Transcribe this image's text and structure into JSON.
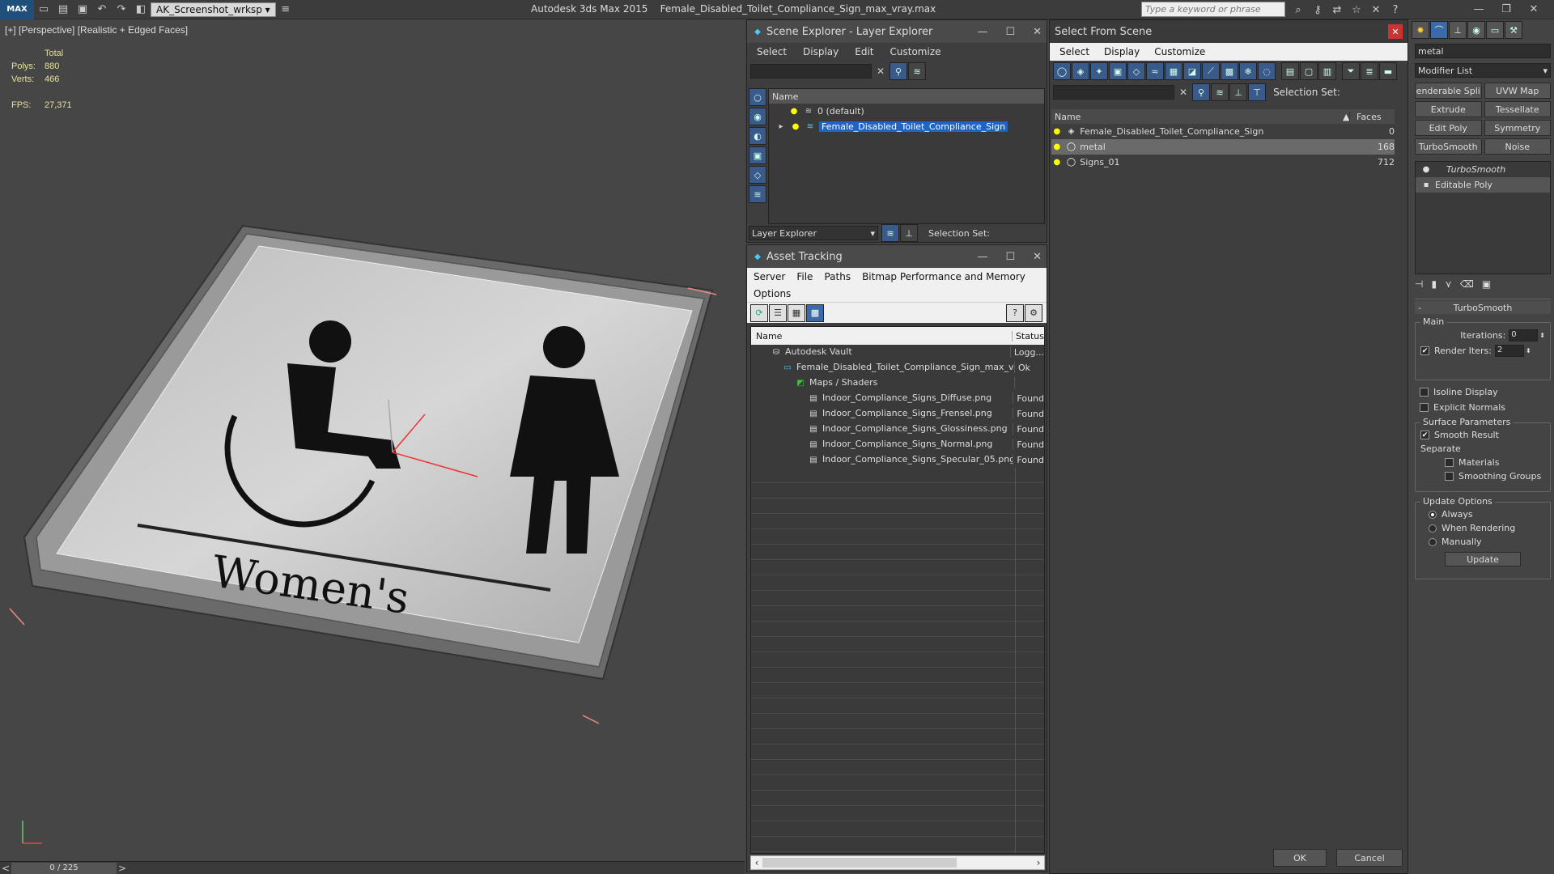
{
  "titlebar": {
    "workspace": "AK_Screenshot_wrksp",
    "app": "Autodesk 3ds Max  2015",
    "file": "Female_Disabled_Toilet_Compliance_Sign_max_vray.max",
    "search_placeholder": "Type a keyword or phrase",
    "logo": "MAX"
  },
  "viewport": {
    "label": "[+] [Perspective] [Realistic + Edged Faces]",
    "stats": {
      "total_label": "Total",
      "polys_label": "Polys:",
      "polys": "880",
      "verts_label": "Verts:",
      "verts": "466",
      "fps_label": "FPS:",
      "fps": "27,371"
    },
    "sign_text": "Women's",
    "timeline": "0 / 225"
  },
  "scene_explorer": {
    "title": "Scene Explorer - Layer Explorer",
    "menu": [
      "Select",
      "Display",
      "Edit",
      "Customize"
    ],
    "col_name": "Name",
    "rows": [
      {
        "label": "0 (default)"
      },
      {
        "label": "Female_Disabled_Toilet_Compliance_Sign"
      }
    ],
    "footer_label": "Layer Explorer",
    "selection_set": "Selection Set:"
  },
  "asset_tracking": {
    "title": "Asset Tracking",
    "menu": [
      "Server",
      "File",
      "Paths",
      "Bitmap Performance and Memory"
    ],
    "menu2": "Options",
    "col_name": "Name",
    "col_status": "Status",
    "rows": [
      {
        "name": "Autodesk Vault",
        "status": "Logg..."
      },
      {
        "name": "Female_Disabled_Toilet_Compliance_Sign_max_v...",
        "status": "Ok"
      },
      {
        "name": "Maps / Shaders",
        "status": ""
      },
      {
        "name": "Indoor_Compliance_Signs_Diffuse.png",
        "status": "Found"
      },
      {
        "name": "Indoor_Compliance_Signs_Frensel.png",
        "status": "Found"
      },
      {
        "name": "Indoor_Compliance_Signs_Glossiness.png",
        "status": "Found"
      },
      {
        "name": "Indoor_Compliance_Signs_Normal.png",
        "status": "Found"
      },
      {
        "name": "Indoor_Compliance_Signs_Specular_05.png",
        "status": "Found"
      }
    ]
  },
  "select_from_scene": {
    "title": "Select From Scene",
    "menu": [
      "Select",
      "Display",
      "Customize"
    ],
    "selection_set": "Selection Set:",
    "col_name": "Name",
    "col_faces": "Faces",
    "rows": [
      {
        "name": "Female_Disabled_Toilet_Compliance_Sign",
        "faces": "0"
      },
      {
        "name": "metal",
        "faces": "168"
      },
      {
        "name": "Signs_01",
        "faces": "712"
      }
    ],
    "ok": "OK",
    "cancel": "Cancel"
  },
  "command_panel": {
    "object_name": "metal",
    "modifier_list": "Modifier List",
    "buttons": [
      "enderable Spli",
      "UVW Map",
      "Extrude",
      "Tessellate",
      "Edit Poly",
      "Symmetry",
      "TurboSmooth",
      "Noise"
    ],
    "stack": [
      "TurboSmooth",
      "Editable Poly"
    ],
    "rollout_title": "TurboSmooth",
    "main_label": "Main",
    "iterations_label": "Iterations:",
    "iterations": "0",
    "render_iters_label": "Render Iters:",
    "render_iters": "2",
    "isoline": "Isoline Display",
    "explicit": "Explicit Normals",
    "surface_label": "Surface Parameters",
    "smooth_result": "Smooth Result",
    "separate": "Separate",
    "materials": "Materials",
    "smoothing_groups": "Smoothing Groups",
    "update_options": "Update Options",
    "always": "Always",
    "when_rendering": "When Rendering",
    "manually": "Manually",
    "update": "Update"
  }
}
